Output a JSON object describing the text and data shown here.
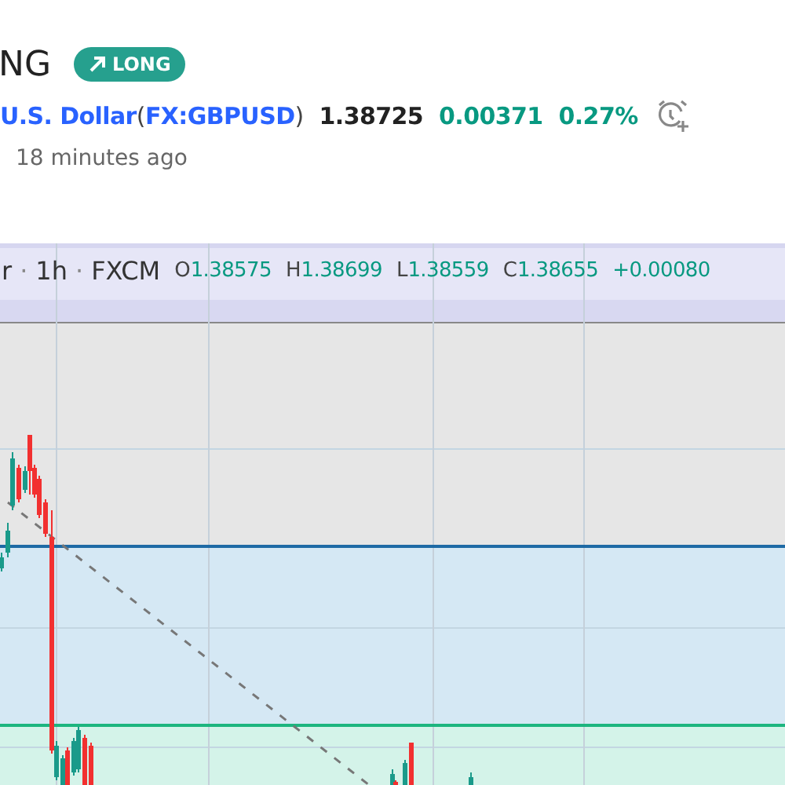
{
  "header": {
    "title": "NG",
    "badge": {
      "label": "LONG"
    }
  },
  "symbol": {
    "name": "U.S. Dollar",
    "open_paren": "(",
    "ticker": "FX:GBPUSD",
    "close_paren": ")",
    "price": "1.38725",
    "change": "0.00371",
    "change_percent": "0.27%"
  },
  "published": "18 minutes ago",
  "legend": {
    "items": [
      {
        "text": "r"
      },
      {
        "text": "1h"
      },
      {
        "text": "FXCM"
      }
    ],
    "separator": "·",
    "ohlc": [
      {
        "label": "O",
        "value": "1.38575"
      },
      {
        "label": "H",
        "value": "1.38699"
      },
      {
        "label": "L",
        "value": "1.38559"
      },
      {
        "label": "C",
        "value": "1.38655"
      }
    ],
    "change": "+0.00080"
  }
}
